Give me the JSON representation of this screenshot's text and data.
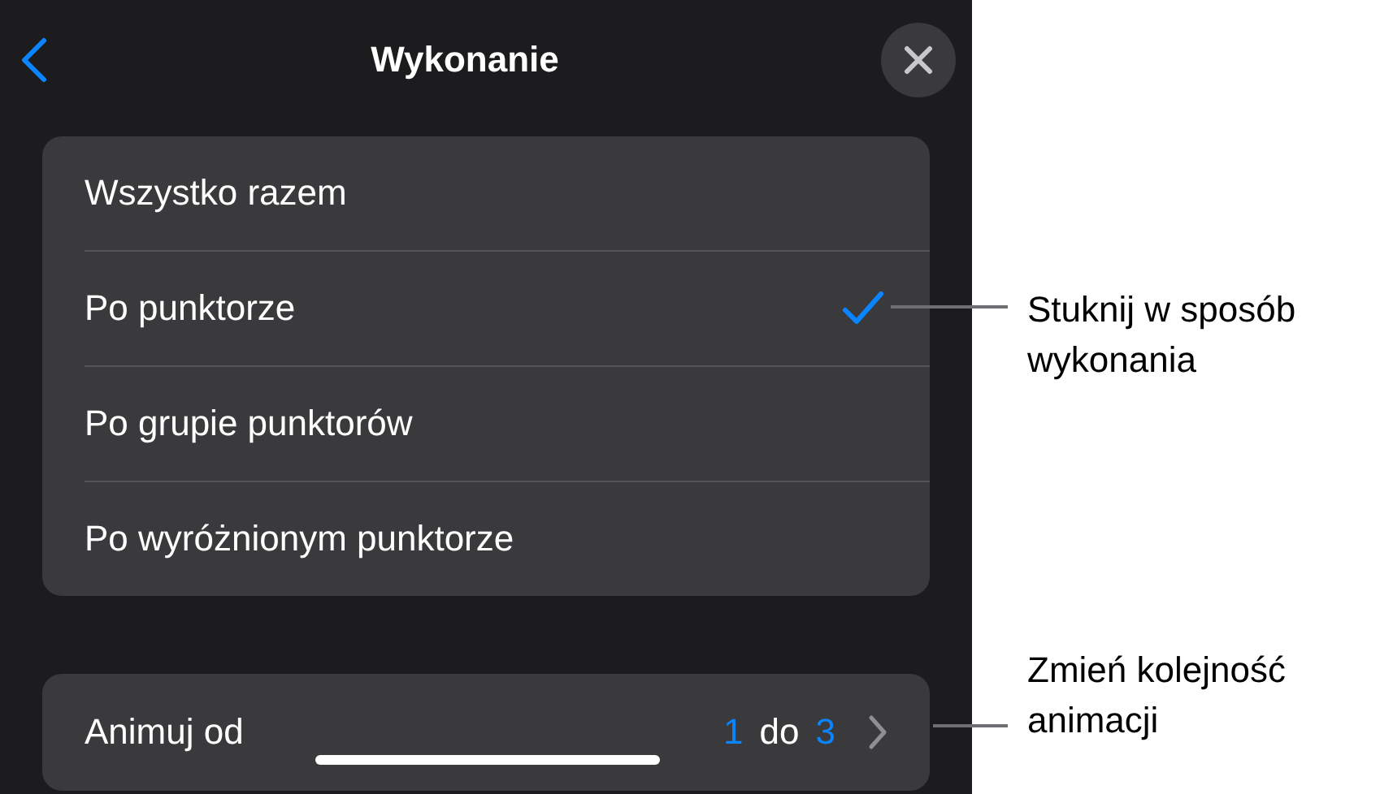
{
  "title": "Wykonanie",
  "options": [
    {
      "label": "Wszystko razem",
      "selected": false
    },
    {
      "label": "Po punktorze",
      "selected": true
    },
    {
      "label": "Po grupie punktorów",
      "selected": false
    },
    {
      "label": "Po wyróżnionym punktorze",
      "selected": false
    }
  ],
  "start": {
    "label": "Animuj od",
    "from": "1",
    "word": "do",
    "to": "3"
  },
  "callouts": [
    "Stuknij w sposób wykonania",
    "Zmień kolejność animacji"
  ]
}
